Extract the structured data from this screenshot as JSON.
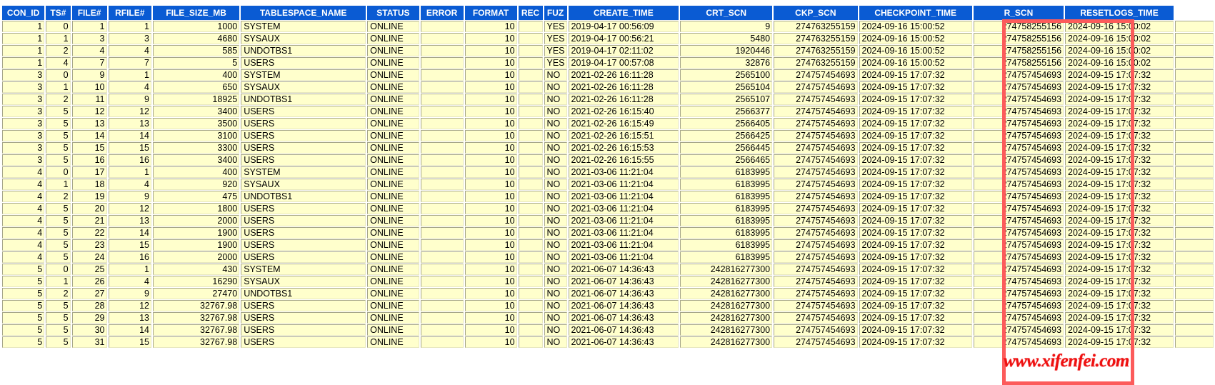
{
  "grid": {
    "columns": [
      {
        "key": "CON_ID",
        "label": "CON_ID",
        "align": "num",
        "cls": "c-con"
      },
      {
        "key": "TS#",
        "label": "TS#",
        "align": "num",
        "cls": "c-ts"
      },
      {
        "key": "FILE#",
        "label": "FILE#",
        "align": "num",
        "cls": "c-file"
      },
      {
        "key": "RFILE#",
        "label": "RFILE#",
        "align": "num",
        "cls": "c-rfile"
      },
      {
        "key": "FILE_SIZE_MB",
        "label": "FILE_SIZE_MB",
        "align": "num",
        "cls": "c-size"
      },
      {
        "key": "TABLESPACE_NAME",
        "label": "TABLESPACE_NAME",
        "align": "txt",
        "cls": "c-tbs"
      },
      {
        "key": "STATUS",
        "label": "STATUS",
        "align": "txt",
        "cls": "c-status"
      },
      {
        "key": "ERROR",
        "label": "ERROR",
        "align": "txt",
        "cls": "c-error"
      },
      {
        "key": "FORMAT",
        "label": "FORMAT",
        "align": "num",
        "cls": "c-format"
      },
      {
        "key": "REC",
        "label": "REC",
        "align": "txt",
        "cls": "c-rec"
      },
      {
        "key": "FUZ",
        "label": "FUZ",
        "align": "txt",
        "cls": "c-fuz"
      },
      {
        "key": "CREATE_TIME",
        "label": "CREATE_TIME",
        "align": "txt",
        "cls": "c-ctime"
      },
      {
        "key": "CRT_SCN",
        "label": "CRT_SCN",
        "align": "num",
        "cls": "c-crtscn"
      },
      {
        "key": "CKP_SCN",
        "label": "CKP_SCN",
        "align": "num",
        "cls": "c-ckpscn"
      },
      {
        "key": "CHECKPOINT_TIME",
        "label": "CHECKPOINT_TIME",
        "align": "txt",
        "cls": "c-ckptime"
      },
      {
        "key": "R_SCN",
        "label": "R_SCN",
        "align": "num",
        "cls": "c-rscn"
      },
      {
        "key": "RESETLOGS_TIME",
        "label": "RESETLOGS_TIME",
        "align": "txt",
        "cls": "c-rstime"
      }
    ],
    "rows": [
      [
        "1",
        "0",
        "1",
        "1",
        "1000",
        "SYSTEM",
        "ONLINE",
        "",
        "10",
        "",
        "YES",
        "2019-04-17 00:56:09",
        "9",
        "274763255159",
        "2024-09-16 15:00:52",
        "274758255156",
        "2024-09-16 15:00:02"
      ],
      [
        "1",
        "1",
        "3",
        "3",
        "4680",
        "SYSAUX",
        "ONLINE",
        "",
        "10",
        "",
        "YES",
        "2019-04-17 00:56:21",
        "5480",
        "274763255159",
        "2024-09-16 15:00:52",
        "274758255156",
        "2024-09-16 15:00:02"
      ],
      [
        "1",
        "2",
        "4",
        "4",
        "585",
        "UNDOTBS1",
        "ONLINE",
        "",
        "10",
        "",
        "YES",
        "2019-04-17 02:11:02",
        "1920446",
        "274763255159",
        "2024-09-16 15:00:52",
        "274758255156",
        "2024-09-16 15:00:02"
      ],
      [
        "1",
        "4",
        "7",
        "7",
        "5",
        "USERS",
        "ONLINE",
        "",
        "10",
        "",
        "YES",
        "2019-04-17 00:57:08",
        "32876",
        "274763255159",
        "2024-09-16 15:00:52",
        "274758255156",
        "2024-09-16 15:00:02"
      ],
      [
        "3",
        "0",
        "9",
        "1",
        "400",
        "SYSTEM",
        "ONLINE",
        "",
        "10",
        "",
        "NO",
        "2021-02-26 16:11:28",
        "2565100",
        "274757454693",
        "2024-09-15 17:07:32",
        "274757454693",
        "2024-09-15 17:07:32"
      ],
      [
        "3",
        "1",
        "10",
        "4",
        "650",
        "SYSAUX",
        "ONLINE",
        "",
        "10",
        "",
        "NO",
        "2021-02-26 16:11:28",
        "2565104",
        "274757454693",
        "2024-09-15 17:07:32",
        "274757454693",
        "2024-09-15 17:07:32"
      ],
      [
        "3",
        "2",
        "11",
        "9",
        "18925",
        "UNDOTBS1",
        "ONLINE",
        "",
        "10",
        "",
        "NO",
        "2021-02-26 16:11:28",
        "2565107",
        "274757454693",
        "2024-09-15 17:07:32",
        "274757454693",
        "2024-09-15 17:07:32"
      ],
      [
        "3",
        "5",
        "12",
        "12",
        "3400",
        "USERS",
        "ONLINE",
        "",
        "10",
        "",
        "NO",
        "2021-02-26 16:15:40",
        "2566377",
        "274757454693",
        "2024-09-15 17:07:32",
        "274757454693",
        "2024-09-15 17:07:32"
      ],
      [
        "3",
        "5",
        "13",
        "13",
        "3500",
        "USERS",
        "ONLINE",
        "",
        "10",
        "",
        "NO",
        "2021-02-26 16:15:49",
        "2566405",
        "274757454693",
        "2024-09-15 17:07:32",
        "274757454693",
        "2024-09-15 17:07:32"
      ],
      [
        "3",
        "5",
        "14",
        "14",
        "3100",
        "USERS",
        "ONLINE",
        "",
        "10",
        "",
        "NO",
        "2021-02-26 16:15:51",
        "2566425",
        "274757454693",
        "2024-09-15 17:07:32",
        "274757454693",
        "2024-09-15 17:07:32"
      ],
      [
        "3",
        "5",
        "15",
        "15",
        "3300",
        "USERS",
        "ONLINE",
        "",
        "10",
        "",
        "NO",
        "2021-02-26 16:15:53",
        "2566445",
        "274757454693",
        "2024-09-15 17:07:32",
        "274757454693",
        "2024-09-15 17:07:32"
      ],
      [
        "3",
        "5",
        "16",
        "16",
        "3400",
        "USERS",
        "ONLINE",
        "",
        "10",
        "",
        "NO",
        "2021-02-26 16:15:55",
        "2566465",
        "274757454693",
        "2024-09-15 17:07:32",
        "274757454693",
        "2024-09-15 17:07:32"
      ],
      [
        "4",
        "0",
        "17",
        "1",
        "400",
        "SYSTEM",
        "ONLINE",
        "",
        "10",
        "",
        "NO",
        "2021-03-06 11:21:04",
        "6183995",
        "274757454693",
        "2024-09-15 17:07:32",
        "274757454693",
        "2024-09-15 17:07:32"
      ],
      [
        "4",
        "1",
        "18",
        "4",
        "920",
        "SYSAUX",
        "ONLINE",
        "",
        "10",
        "",
        "NO",
        "2021-03-06 11:21:04",
        "6183995",
        "274757454693",
        "2024-09-15 17:07:32",
        "274757454693",
        "2024-09-15 17:07:32"
      ],
      [
        "4",
        "2",
        "19",
        "9",
        "475",
        "UNDOTBS1",
        "ONLINE",
        "",
        "10",
        "",
        "NO",
        "2021-03-06 11:21:04",
        "6183995",
        "274757454693",
        "2024-09-15 17:07:32",
        "274757454693",
        "2024-09-15 17:07:32"
      ],
      [
        "4",
        "5",
        "20",
        "12",
        "1800",
        "USERS",
        "ONLINE",
        "",
        "10",
        "",
        "NO",
        "2021-03-06 11:21:04",
        "6183995",
        "274757454693",
        "2024-09-15 17:07:32",
        "274757454693",
        "2024-09-15 17:07:32"
      ],
      [
        "4",
        "5",
        "21",
        "13",
        "2000",
        "USERS",
        "ONLINE",
        "",
        "10",
        "",
        "NO",
        "2021-03-06 11:21:04",
        "6183995",
        "274757454693",
        "2024-09-15 17:07:32",
        "274757454693",
        "2024-09-15 17:07:32"
      ],
      [
        "4",
        "5",
        "22",
        "14",
        "1900",
        "USERS",
        "ONLINE",
        "",
        "10",
        "",
        "NO",
        "2021-03-06 11:21:04",
        "6183995",
        "274757454693",
        "2024-09-15 17:07:32",
        "274757454693",
        "2024-09-15 17:07:32"
      ],
      [
        "4",
        "5",
        "23",
        "15",
        "1900",
        "USERS",
        "ONLINE",
        "",
        "10",
        "",
        "NO",
        "2021-03-06 11:21:04",
        "6183995",
        "274757454693",
        "2024-09-15 17:07:32",
        "274757454693",
        "2024-09-15 17:07:32"
      ],
      [
        "4",
        "5",
        "24",
        "16",
        "2000",
        "USERS",
        "ONLINE",
        "",
        "10",
        "",
        "NO",
        "2021-03-06 11:21:04",
        "6183995",
        "274757454693",
        "2024-09-15 17:07:32",
        "274757454693",
        "2024-09-15 17:07:32"
      ],
      [
        "5",
        "0",
        "25",
        "1",
        "430",
        "SYSTEM",
        "ONLINE",
        "",
        "10",
        "",
        "NO",
        "2021-06-07 14:36:43",
        "242816277300",
        "274757454693",
        "2024-09-15 17:07:32",
        "274757454693",
        "2024-09-15 17:07:32"
      ],
      [
        "5",
        "1",
        "26",
        "4",
        "16290",
        "SYSAUX",
        "ONLINE",
        "",
        "10",
        "",
        "NO",
        "2021-06-07 14:36:43",
        "242816277300",
        "274757454693",
        "2024-09-15 17:07:32",
        "274757454693",
        "2024-09-15 17:07:32"
      ],
      [
        "5",
        "2",
        "27",
        "9",
        "27470",
        "UNDOTBS1",
        "ONLINE",
        "",
        "10",
        "",
        "NO",
        "2021-06-07 14:36:43",
        "242816277300",
        "274757454693",
        "2024-09-15 17:07:32",
        "274757454693",
        "2024-09-15 17:07:32"
      ],
      [
        "5",
        "5",
        "28",
        "12",
        "32767.98",
        "USERS",
        "ONLINE",
        "",
        "10",
        "",
        "NO",
        "2021-06-07 14:36:43",
        "242816277300",
        "274757454693",
        "2024-09-15 17:07:32",
        "274757454693",
        "2024-09-15 17:07:32"
      ],
      [
        "5",
        "5",
        "29",
        "13",
        "32767.98",
        "USERS",
        "ONLINE",
        "",
        "10",
        "",
        "NO",
        "2021-06-07 14:36:43",
        "242816277300",
        "274757454693",
        "2024-09-15 17:07:32",
        "274757454693",
        "2024-09-15 17:07:32"
      ],
      [
        "5",
        "5",
        "30",
        "14",
        "32767.98",
        "USERS",
        "ONLINE",
        "",
        "10",
        "",
        "NO",
        "2021-06-07 14:36:43",
        "242816277300",
        "274757454693",
        "2024-09-15 17:07:32",
        "274757454693",
        "2024-09-15 17:07:32"
      ],
      [
        "5",
        "5",
        "31",
        "15",
        "32767.98",
        "USERS",
        "ONLINE",
        "",
        "10",
        "",
        "NO",
        "2021-06-07 14:36:43",
        "242816277300",
        "274757454693",
        "2024-09-15 17:07:32",
        "274757454693",
        "2024-09-15 17:07:32"
      ]
    ]
  },
  "annotations": {
    "highlight_box": {
      "label": "red-highlight-rectangle",
      "color": "#fc5b5b",
      "covers_columns": [
        "R_SCN",
        "RESETLOGS_TIME"
      ]
    },
    "watermark": {
      "text": "www.xifenfei.com",
      "color": "#ee1111"
    }
  },
  "colors": {
    "header_background": "#0a5bd3",
    "header_text": "#ffffff",
    "cell_background": "#ffffcc",
    "cell_text": "#000000",
    "cell_border": "#a6a68a",
    "highlight": "#fc5b5b",
    "watermark": "#ee1111"
  }
}
